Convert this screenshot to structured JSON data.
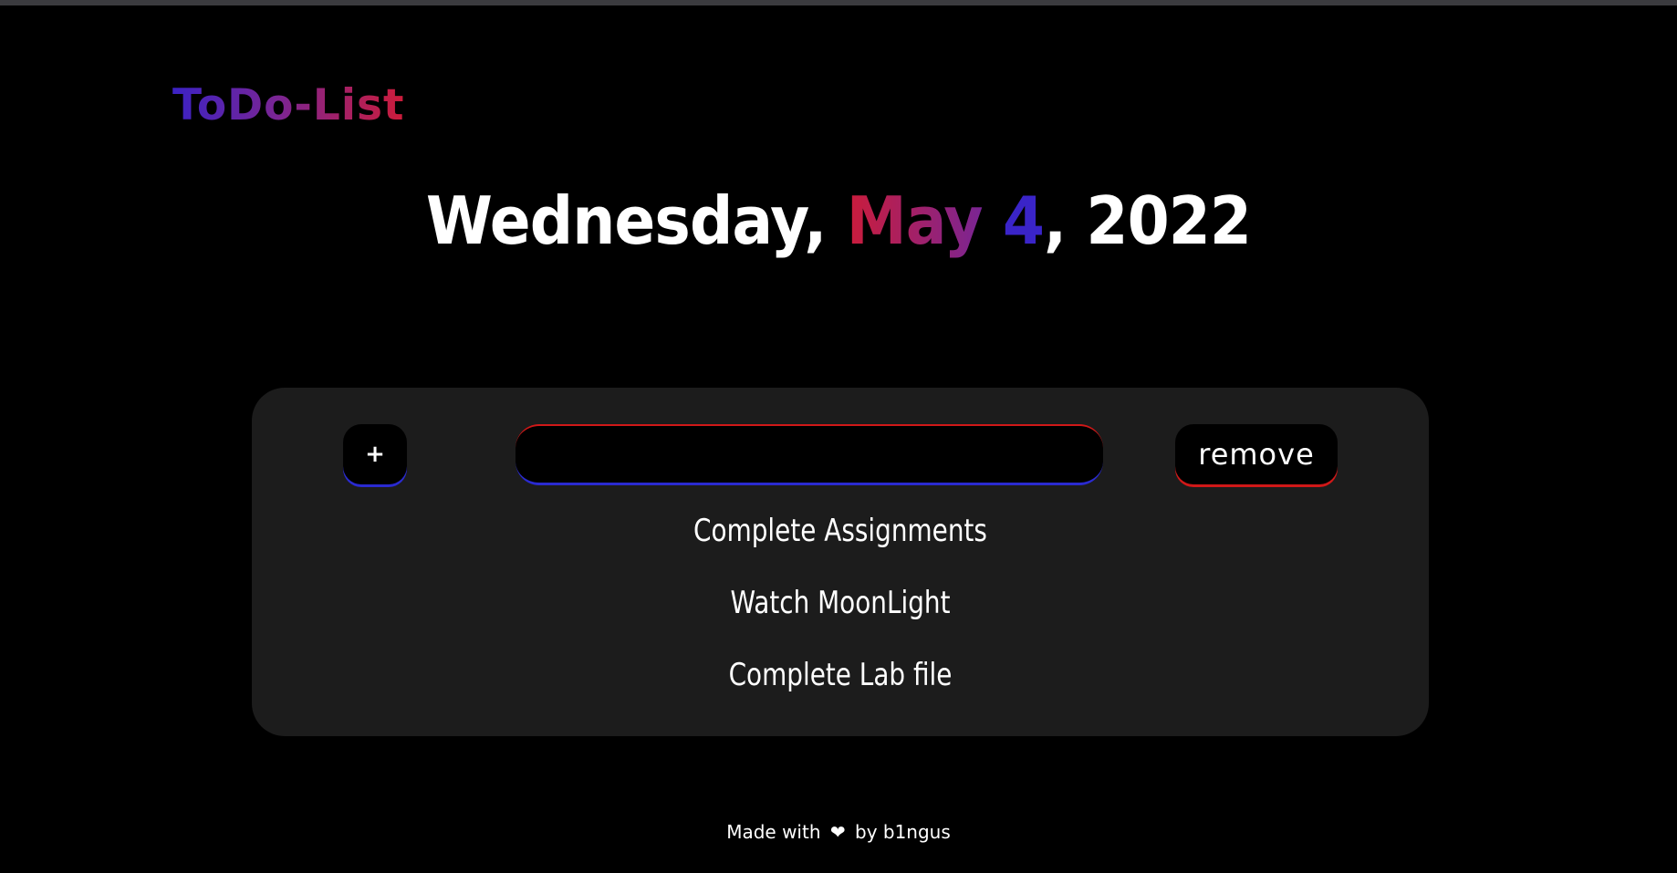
{
  "header": {
    "logo": "ToDo-List"
  },
  "date": {
    "weekday": "Wednesday,",
    "month": "May",
    "day": "4",
    "year": ", 2022"
  },
  "controls": {
    "add_label": "+",
    "input_value": "",
    "remove_label": "remove"
  },
  "todos": [
    "Complete Assignments",
    "Watch MoonLight",
    "Complete Lab file"
  ],
  "footer": {
    "prefix": "Made with",
    "icon": "heart-icon",
    "suffix": "by b1ngus"
  },
  "colors": {
    "blue": "#3a24c8",
    "red": "#cc1c3a",
    "card": "#1c1c1c"
  }
}
